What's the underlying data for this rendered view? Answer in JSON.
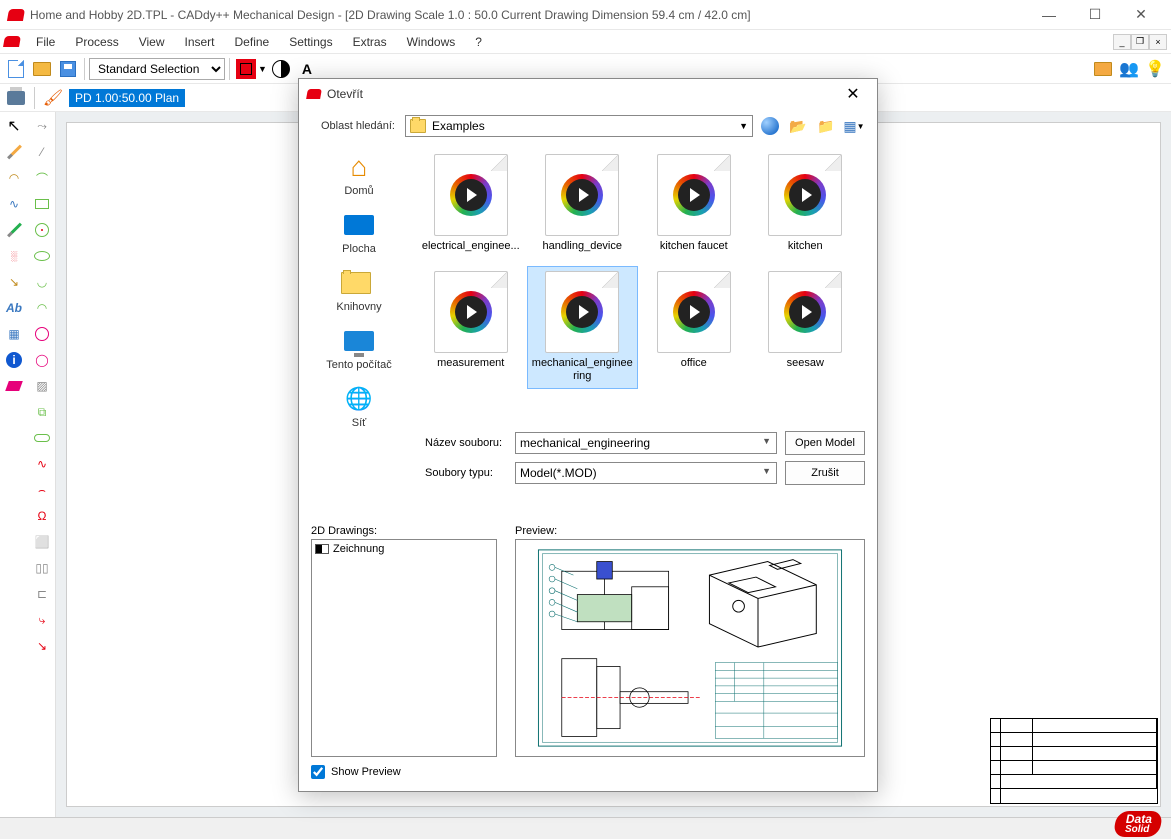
{
  "title": "Home and Hobby 2D.TPL  -  CADdy++ Mechanical Design - [2D Drawing   Scale 1.0 : 50.0   Current Drawing Dimension 59.4 cm / 42.0 cm]",
  "menu": [
    "File",
    "Process",
    "View",
    "Insert",
    "Define",
    "Settings",
    "Extras",
    "Windows",
    "?"
  ],
  "toolbar1": {
    "selection_mode": "Standard Selection",
    "a_label": "A"
  },
  "toolbar2": {
    "plan": "PD 1.00:50.00 Plan"
  },
  "dialog": {
    "title": "Otevřít",
    "search_label": "Oblast hledání:",
    "folder": "Examples",
    "places": [
      {
        "label": "Domů",
        "icon": "home"
      },
      {
        "label": "Plocha",
        "icon": "desktop"
      },
      {
        "label": "Knihovny",
        "icon": "libraries"
      },
      {
        "label": "Tento počítač",
        "icon": "computer"
      },
      {
        "label": "Síť",
        "icon": "network"
      }
    ],
    "files": [
      {
        "label": "electrical_enginee..."
      },
      {
        "label": "handling_device"
      },
      {
        "label": "kitchen faucet"
      },
      {
        "label": "kitchen"
      },
      {
        "label": "measurement"
      },
      {
        "label": "mechanical_engineering",
        "selected": true
      },
      {
        "label": "office"
      },
      {
        "label": "seesaw"
      }
    ],
    "filename_label": "Název souboru:",
    "filename_value": "mechanical_engineering",
    "filetype_label": "Soubory typu:",
    "filetype_value": "Model(*.MOD)",
    "open_btn": "Open Model",
    "cancel_btn": "Zrušit",
    "drawings_label": "2D Drawings:",
    "drawings": [
      "Zeichnung"
    ],
    "preview_label": "Preview:",
    "show_preview": "Show Preview"
  },
  "footer_logo": {
    "line1": "Data",
    "line2": "Solid"
  }
}
